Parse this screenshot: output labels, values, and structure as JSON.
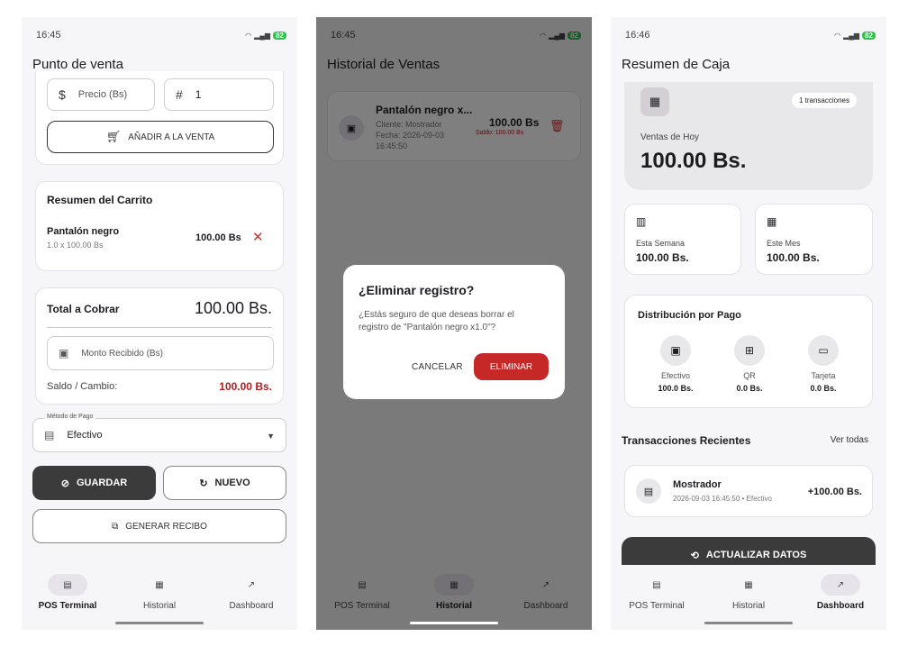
{
  "p1": {
    "time": "16:45",
    "battery": "82",
    "title": "Punto de venta",
    "price_placeholder": "Precio (Bs)",
    "qty_value": "1",
    "add_button": "AÑADIR A LA VENTA",
    "cart": {
      "title": "Resumen del Carrito",
      "item_name": "Pantalón negro",
      "item_detail": "1.0 x 100.00 Bs",
      "item_total": "100.00 Bs"
    },
    "total": {
      "label": "Total a Cobrar",
      "value": "100.00 Bs.",
      "received_placeholder": "Monto Recibido (Bs)",
      "balance_label": "Saldo / Cambio:",
      "balance_value": "100.00 Bs."
    },
    "payment": {
      "label": "Método de Pago",
      "value": "Efectivo"
    },
    "save_button": "GUARDAR",
    "new_button": "NUEVO",
    "receipt_button": "GENERAR RECIBO"
  },
  "p2": {
    "time": "16:45",
    "battery": "82",
    "title": "Historial de Ventas",
    "sale": {
      "name": "Pantalón negro x...",
      "client": "Cliente: Mostrador",
      "date": "Fecha: 2026-09-03",
      "time": "16:45:50",
      "amount": "100.00 Bs",
      "balance": "Saldo: 100.00 Bs"
    },
    "dialog": {
      "title": "¿Eliminar registro?",
      "body": "¿Estás seguro de que deseas borrar el registro de \"Pantalón negro x1.0\"?",
      "cancel": "CANCELAR",
      "confirm": "ELIMINAR"
    }
  },
  "p3": {
    "time": "16:46",
    "battery": "82",
    "title": "Resumen de Caja",
    "today": {
      "badge": "1 transacciones",
      "label": "Ventas de Hoy",
      "value": "100.00 Bs."
    },
    "week": {
      "label": "Esta Semana",
      "value": "100.00 Bs."
    },
    "month": {
      "label": "Este Mes",
      "value": "100.00 Bs."
    },
    "distribution": {
      "title": "Distribución por Pago",
      "items": [
        {
          "label": "Efectivo",
          "value": "100.0 Bs."
        },
        {
          "label": "QR",
          "value": "0.0 Bs."
        },
        {
          "label": "Tarjeta",
          "value": "0.0 Bs."
        }
      ]
    },
    "recent": {
      "title": "Transacciones Recientes",
      "see_all": "Ver todas",
      "name": "Mostrador",
      "detail": "2026-09-03 16:45:50 • Efectivo",
      "amount": "+100.00 Bs."
    },
    "refresh_button": "ACTUALIZAR DATOS"
  },
  "nav": {
    "pos": "POS Terminal",
    "history": "Historial",
    "dashboard": "Dashboard"
  },
  "colors": {
    "accent_red": "#b71c1c",
    "dark_button": "#3b3b3b"
  }
}
